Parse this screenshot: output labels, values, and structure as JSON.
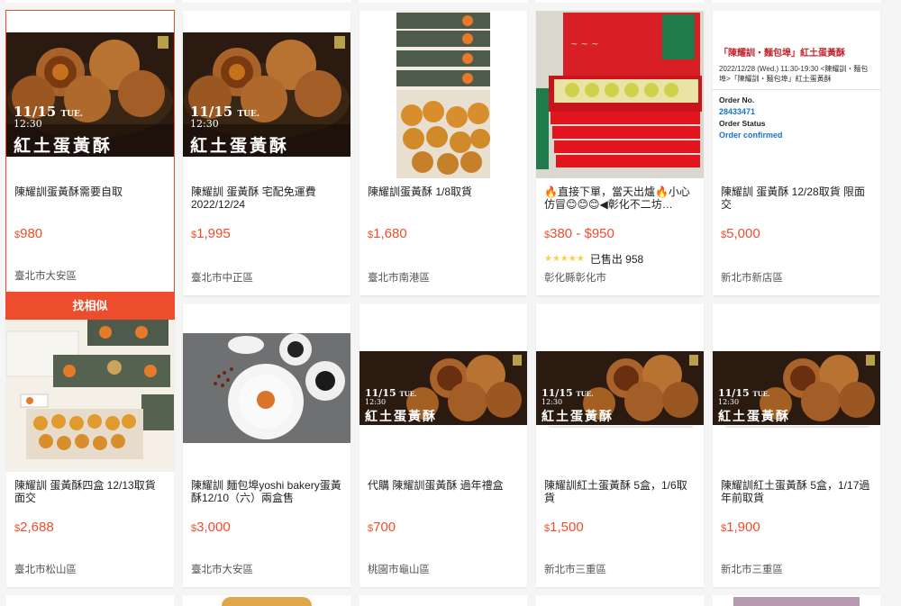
{
  "find_similar_label": "找相似",
  "banner": {
    "date": "11/15",
    "dow": "TUE.",
    "time": "12:30",
    "name": "紅土蛋黃酥"
  },
  "order_card": {
    "heading": "「陳耀訓・麵包埠」紅土蛋黃酥",
    "line": "2022/12/28 (Wed.) 11:30-19:30 <陳耀訓・麵包埠>「陳耀訓・麵包埠」紅土蛋黃酥",
    "order_no_label": "Order No.",
    "order_no": "28433471",
    "status_label": "Order Status",
    "status": "Order confirmed"
  },
  "products": [
    {
      "title": "陳耀訓蛋黃酥需要自取",
      "price": "980",
      "location": "臺北市大安區"
    },
    {
      "title": "陳耀訓 蛋黃酥 宅配免運費 2022/12/24",
      "price": "1,995",
      "location": "臺北市中正區"
    },
    {
      "title": "陳耀訓蛋黃酥 1/8取貨",
      "price": "1,680",
      "location": "臺北市南港區"
    },
    {
      "title": "🔥直接下單，當天出爐🔥小心仿冒😊😊😊◀彰化不二坊…",
      "price": "380 - $950",
      "stars": "★★★★★",
      "sold": "已售出 958",
      "location": "彰化縣彰化市"
    },
    {
      "title": "陳耀訓 蛋黃酥 12/28取貨 限面交",
      "price": "5,000",
      "location": "新北市新店區"
    },
    {
      "title": "陳耀訓 蛋黃酥四盒 12/13取貨面交",
      "price": "2,688",
      "location": "臺北市松山區"
    },
    {
      "title": "陳耀訓 麵包埠yoshi bakery蛋黃酥12/10（六）兩盒售",
      "price": "3,000",
      "location": "臺北市大安區"
    },
    {
      "title": "代購 陳耀訓蛋黃酥 過年禮盒",
      "price": "700",
      "location": "桃園市龜山區"
    },
    {
      "title": "陳耀訓紅土蛋黃酥 5盒，1/6取貨",
      "price": "1,500",
      "location": "新北市三重區"
    },
    {
      "title": "陳耀訓紅土蛋黃酥 5盒，1/17過年前取貨",
      "price": "1,900",
      "location": "新北市三重區"
    }
  ],
  "currency": "$",
  "colors": {
    "accent": "#ee4d2d",
    "star": "#ffce3d",
    "order_link": "#1a73c8"
  }
}
